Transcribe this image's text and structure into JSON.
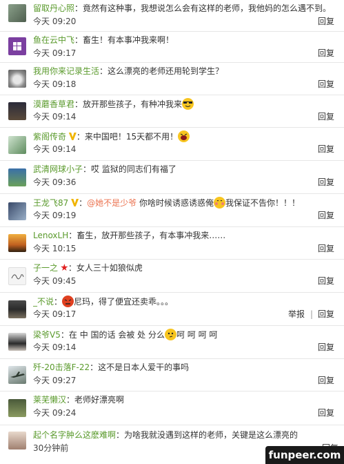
{
  "comments": [
    {
      "user": "留取丹心照",
      "text": "竟然有这种事，我想说怎么会有这样的老师，我他妈的怎么遇不到。",
      "time": "今天 09:20",
      "reply": "回复"
    },
    {
      "user": "鱼在云中飞",
      "text": "畜生！有本事冲我来啊！",
      "time": "今天 09:17",
      "reply": "回复"
    },
    {
      "user": "我用你来记录生活",
      "text": "这么漂亮的老师还用轮到学生？",
      "time": "今天 09:18",
      "reply": "回复"
    },
    {
      "user": "漠蘑香草君",
      "text": "放开那些孩子，有种冲我来",
      "time": "今天 09:14",
      "reply": "回复"
    },
    {
      "user": "紫阁传奇",
      "text": "来中国吧！15天都不用！",
      "time": "今天 09:14",
      "reply": "回复"
    },
    {
      "user": "武清网球小子",
      "text": "哎 监狱的同志们有福了",
      "time": "今天 09:36",
      "reply": "回复"
    },
    {
      "user": "王龙飞87",
      "mention": "@她不是少爷",
      "text": "你啥时候诱惑诱惑俺",
      "text2": "我保证不告你！！！",
      "time": "今天 09:19",
      "reply": "回复"
    },
    {
      "user": "LenoxLH",
      "text": "畜生，放开那些孩子，有本事冲我来……",
      "time": "今天 10:15",
      "reply": "回复"
    },
    {
      "user": "子一之",
      "text": "女人三十如狼似虎",
      "time": "今天 09:45",
      "reply": "回复"
    },
    {
      "user": "_不说",
      "text": "尼玛，得了便宜还卖乖。。。",
      "time": "今天 09:17",
      "report": "举报",
      "reply": "回复"
    },
    {
      "user": "梁爷V5",
      "text": "在 中 国的话 会被 处 分么",
      "text2": "呵 呵 呵 呵",
      "time": "今天 09:14",
      "reply": "回复"
    },
    {
      "user": "歼-20击落F-22",
      "text": "这不是日本人爱干的事吗",
      "time": "今天 09:27",
      "reply": "回复"
    },
    {
      "user": "莱芜懒汉",
      "text": "老师好漂亮啊",
      "time": "今天 09:24",
      "reply": "回复"
    },
    {
      "user": "起个名字肿么这麽难啊",
      "text": "为啥我就没遇到这样的老师，关键是这么漂亮的",
      "time": "30分钟前",
      "reply": "回复"
    }
  ],
  "watermark": "funpeer.com",
  "colors": {
    "username": "#eb7350",
    "username_green": "#5a9a2c"
  }
}
